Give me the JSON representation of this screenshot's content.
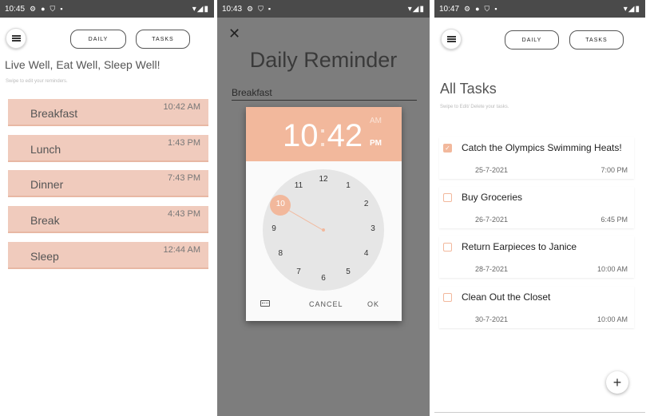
{
  "panel1": {
    "status_time": "10:45",
    "daily_label": "DAILY",
    "tasks_label": "TASKS",
    "headline": "Live Well, Eat Well, Sleep Well!",
    "hint": "Swipe to edit your reminders.",
    "reminders": [
      {
        "name": "Breakfast",
        "time": "10:42 AM"
      },
      {
        "name": "Lunch",
        "time": "1:43 PM"
      },
      {
        "name": "Dinner",
        "time": "7:43 PM"
      },
      {
        "name": "Break",
        "time": "4:43 PM"
      },
      {
        "name": "Sleep",
        "time": "12:44 AM"
      }
    ]
  },
  "panel2": {
    "status_time": "10:43",
    "close_glyph": "✕",
    "title": "Daily Reminder",
    "field_value": "Breakfast",
    "picker": {
      "hour": "10",
      "minute": "42",
      "am_label": "AM",
      "pm_label": "PM",
      "selected_hour": 10,
      "hours": [
        "12",
        "1",
        "2",
        "3",
        "4",
        "5",
        "6",
        "7",
        "8",
        "9",
        "10",
        "11"
      ],
      "cancel_label": "CANCEL",
      "ok_label": "OK"
    }
  },
  "panel3": {
    "status_time": "10:47",
    "daily_label": "DAILY",
    "tasks_label": "TASKS",
    "title": "All Tasks",
    "hint": "Swipe to Edit/ Delete your tasks.",
    "fab_label": "+",
    "tasks": [
      {
        "title": "Catch the Olympics Swimming Heats!",
        "date": "25-7-2021",
        "time": "7:00 PM",
        "checked": true
      },
      {
        "title": "Buy Groceries",
        "date": "26-7-2021",
        "time": "6:45 PM",
        "checked": false
      },
      {
        "title": "Return Earpieces to Janice",
        "date": "28-7-2021",
        "time": "10:00 AM",
        "checked": false
      },
      {
        "title": "Clean Out the Closet",
        "date": "30-7-2021",
        "time": "10:00 AM",
        "checked": false
      }
    ]
  },
  "colors": {
    "accent": "#f2b89c",
    "card": "#f0cbbd",
    "statusbar": "#4a4a4a"
  }
}
